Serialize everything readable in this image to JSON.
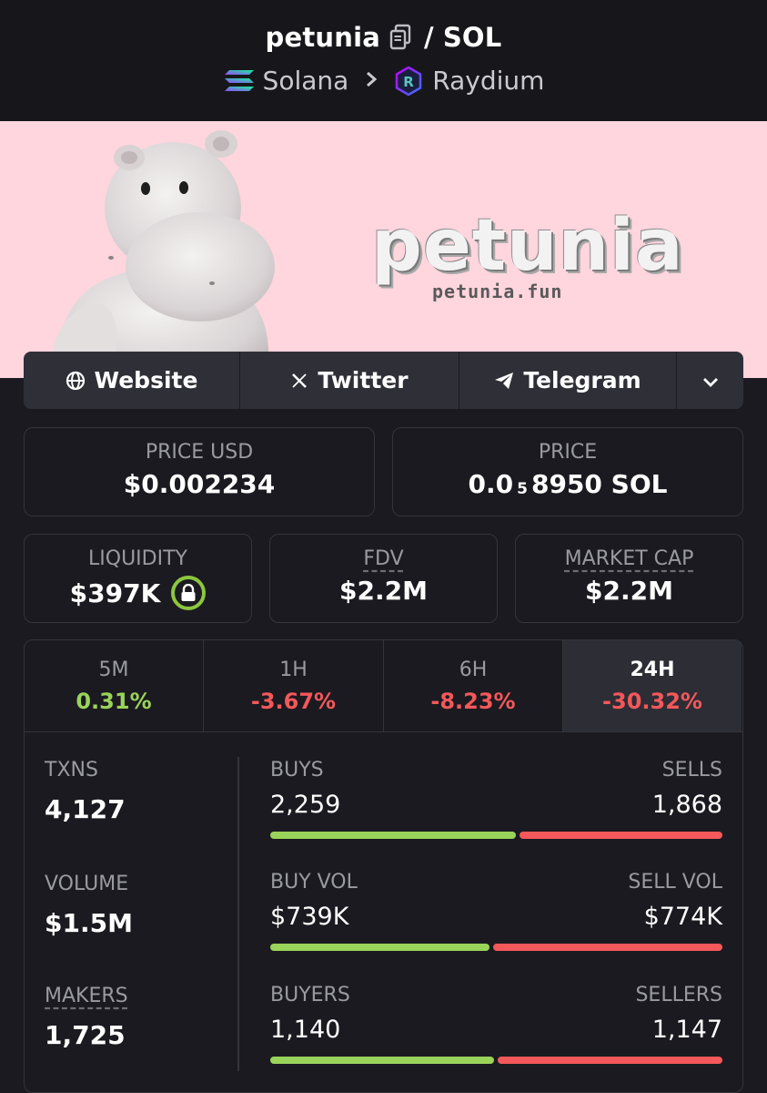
{
  "header": {
    "token_name": "petunia",
    "separator": "/",
    "quote": "SOL",
    "chain": "Solana",
    "dex": "Raydium"
  },
  "banner": {
    "brand": "petunia",
    "url": "petunia.fun"
  },
  "links": {
    "website": "Website",
    "twitter": "Twitter",
    "telegram": "Telegram"
  },
  "price": {
    "usd_label": "PRICE USD",
    "usd_value": "$0.002234",
    "native_label": "PRICE",
    "native_prefix": "0.0",
    "native_zeros": "5",
    "native_suffix": "8950 SOL"
  },
  "metrics": {
    "liquidity_label": "LIQUIDITY",
    "liquidity_value": "$397K",
    "fdv_label": "FDV",
    "fdv_value": "$2.2M",
    "mcap_label": "MARKET CAP",
    "mcap_value": "$2.2M"
  },
  "timeframes": [
    {
      "label": "5M",
      "change": "0.31%",
      "direction": "up"
    },
    {
      "label": "1H",
      "change": "-3.67%",
      "direction": "down"
    },
    {
      "label": "6H",
      "change": "-8.23%",
      "direction": "down"
    },
    {
      "label": "24H",
      "change": "-30.32%",
      "direction": "down",
      "active": true
    }
  ],
  "stats": {
    "txns_label": "TXNS",
    "txns_value": "4,127",
    "volume_label": "VOLUME",
    "volume_value": "$1.5M",
    "makers_label": "MAKERS",
    "makers_value": "1,725"
  },
  "breakdown": [
    {
      "left_label": "BUYS",
      "right_label": "SELLS",
      "left_value": "2,259",
      "right_value": "1,868",
      "buy_fraction": 0.547
    },
    {
      "left_label": "BUY VOL",
      "right_label": "SELL VOL",
      "left_value": "$739K",
      "right_value": "$774K",
      "buy_fraction": 0.488
    },
    {
      "left_label": "BUYERS",
      "right_label": "SELLERS",
      "left_value": "1,140",
      "right_value": "1,147",
      "buy_fraction": 0.498
    }
  ],
  "colors": {
    "buy": "#9ad35a",
    "sell": "#f3585a",
    "background": "#1b1a20",
    "banner": "#ffd5de"
  }
}
